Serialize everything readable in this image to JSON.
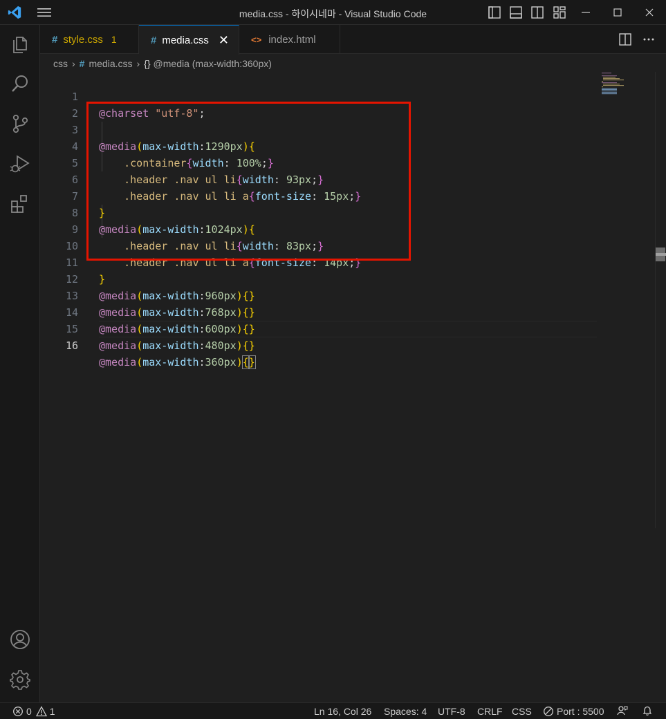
{
  "window": {
    "title": "media.css - 하이시네마 - Visual Studio Code"
  },
  "tabs": [
    {
      "label": "style.css",
      "badge": "1"
    },
    {
      "label": "media.css",
      "close": "✕"
    },
    {
      "label": "index.html"
    }
  ],
  "breadcrumb": {
    "folder": "css",
    "file": "media.css",
    "symbol": "@media (max-width:360px)"
  },
  "editor": {
    "line_numbers": [
      "1",
      "2",
      "3",
      "4",
      "5",
      "6",
      "7",
      "8",
      "9",
      "10",
      "11",
      "12",
      "13",
      "14",
      "15",
      "16"
    ],
    "code": {
      "l1": {
        "kw": "@charset",
        "str": "\"utf-8\"",
        "semi": ";"
      },
      "l3": {
        "kw": "@media",
        "open": "(",
        "prop": "max-width",
        "colon": ":",
        "num": "1290px",
        "close": ")",
        "brace": "{"
      },
      "l4": {
        "sel": ".container",
        "open": "{",
        "prop": "width",
        "colon": ":",
        "num": "100%",
        "semi": ";",
        "close": "}"
      },
      "l5": {
        "sel": ".header .nav ul li",
        "open": "{",
        "prop": "width",
        "colon": ":",
        "num": "93px",
        "semi": ";",
        "close": "}"
      },
      "l6": {
        "sel": ".header .nav ul li a",
        "open": "{",
        "prop": "font-size",
        "colon": ":",
        "num": "15px",
        "semi": ";",
        "close": "}"
      },
      "l7": {
        "brace": "}"
      },
      "l8": {
        "kw": "@media",
        "open": "(",
        "prop": "max-width",
        "colon": ":",
        "num": "1024px",
        "close": ")",
        "brace": "{"
      },
      "l9": {
        "sel": ".header .nav ul li",
        "open": "{",
        "prop": "width",
        "colon": ":",
        "num": "83px",
        "semi": ";",
        "close": "}"
      },
      "l10": {
        "sel": ".header .nav ul li a",
        "open": "{",
        "prop": "font-size",
        "colon": ":",
        "num": "14px",
        "semi": ";",
        "close": "}"
      },
      "l11": {
        "brace": "}"
      },
      "l12": {
        "kw": "@media",
        "open": "(",
        "prop": "max-width",
        "colon": ":",
        "num": "960px",
        "close": ")",
        "braces": "{}"
      },
      "l13": {
        "kw": "@media",
        "open": "(",
        "prop": "max-width",
        "colon": ":",
        "num": "768px",
        "close": ")",
        "braces": "{}"
      },
      "l14": {
        "kw": "@media",
        "open": "(",
        "prop": "max-width",
        "colon": ":",
        "num": "600px",
        "close": ")",
        "braces": "{}"
      },
      "l15": {
        "kw": "@media",
        "open": "(",
        "prop": "max-width",
        "colon": ":",
        "num": "480px",
        "close": ")",
        "braces": "{}"
      },
      "l16": {
        "kw": "@media",
        "open": "(",
        "prop": "max-width",
        "colon": ":",
        "num": "360px",
        "close": ")",
        "bopen": "{",
        "bclose": "}"
      }
    }
  },
  "statusbar": {
    "errors": "0",
    "warnings": "1",
    "position": "Ln 16, Col 26",
    "spaces": "Spaces: 4",
    "encoding": "UTF-8",
    "eol": "CRLF",
    "language": "CSS",
    "port": "Port : 5500"
  },
  "icons": {
    "activity": [
      "files-icon",
      "search-icon",
      "source-control-icon",
      "run-debug-icon",
      "extensions-icon",
      "accounts-icon",
      "manage-gear-icon"
    ]
  },
  "colors": {
    "accent": "#0078d4",
    "highlight_box": "#e51400",
    "modified": "#cca700"
  }
}
